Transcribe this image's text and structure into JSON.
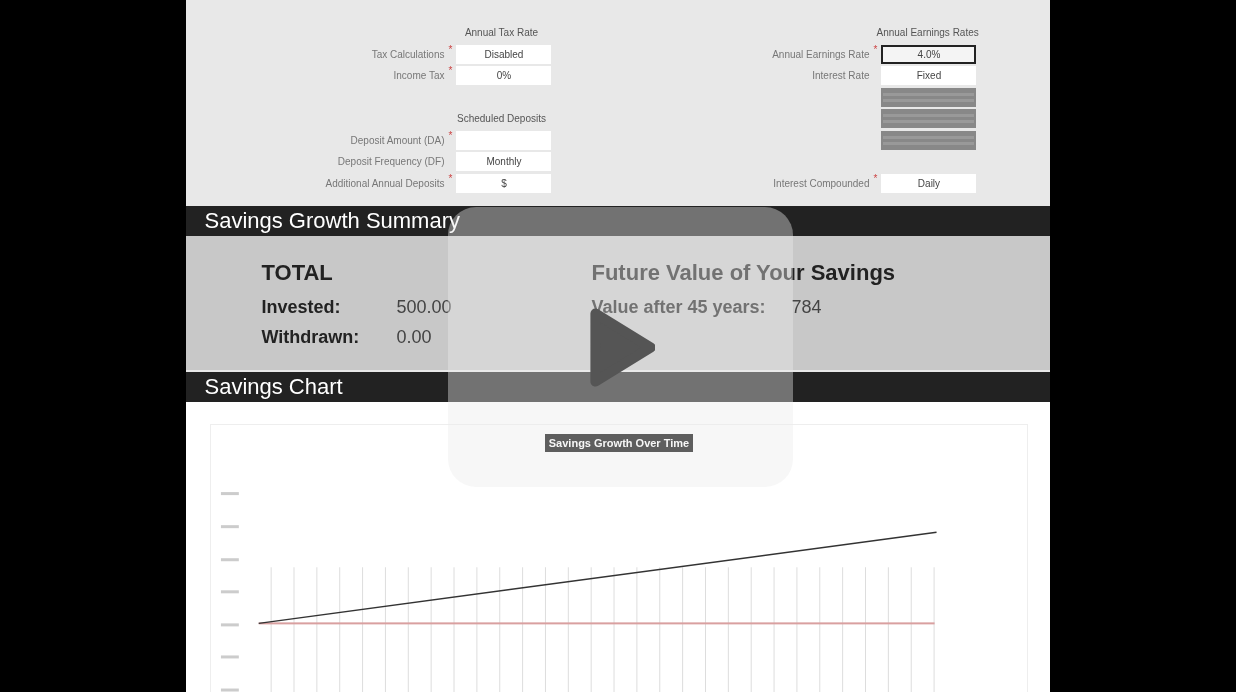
{
  "left_sections": [
    {
      "heading": "Annual Tax Rate",
      "fields": [
        {
          "kind": "input",
          "label": "Tax Calculations",
          "value": "Disabled",
          "mark": "*",
          "selected": false
        },
        {
          "kind": "input",
          "label": "Income Tax",
          "value": "0%",
          "mark": "*",
          "selected": false
        }
      ]
    },
    {
      "heading": "Scheduled Deposits",
      "fields": [
        {
          "kind": "input",
          "label": "Deposit Amount (DA)",
          "mark": "*",
          "selected": false
        },
        {
          "kind": "input",
          "label": "Deposit Frequency (DF)",
          "value": "Monthly",
          "selected": false
        },
        {
          "kind": "input",
          "label": "Additional Annual Deposits",
          "value": "$",
          "mark": "*",
          "selected": false
        }
      ]
    }
  ],
  "right_section": {
    "heading": "Annual Earnings Rates",
    "fields": [
      {
        "kind": "input",
        "label": "Annual Earnings Rate",
        "value": "4.0%",
        "mark": "*",
        "selected": true
      },
      {
        "kind": "input",
        "label": "Interest Rate",
        "value": "Fixed",
        "selected": false
      },
      {
        "kind": "disabled",
        "selected": false
      },
      {
        "kind": "disabled",
        "selected": false
      },
      {
        "kind": "disabled",
        "selected": false
      },
      {
        "kind": "blank"
      },
      {
        "kind": "input",
        "label": "Interest Compounded",
        "value": "Daily",
        "mark": "*",
        "selected": false
      }
    ]
  },
  "summary": {
    "title": "Savings Growth Summary",
    "total": {
      "heading": "TOTAL",
      "rows": [
        {
          "label": "Invested:",
          "value": "500.00"
        },
        {
          "label": "Withdrawn:",
          "value": "0.00"
        }
      ]
    },
    "future": {
      "heading": "Future Value of Your Savings",
      "rows": [
        {
          "label": "Value after 45 years:",
          "value": "784"
        }
      ]
    }
  },
  "chart": {
    "title": "Savings Chart",
    "chart_title": "Savings Growth Over Time"
  }
}
